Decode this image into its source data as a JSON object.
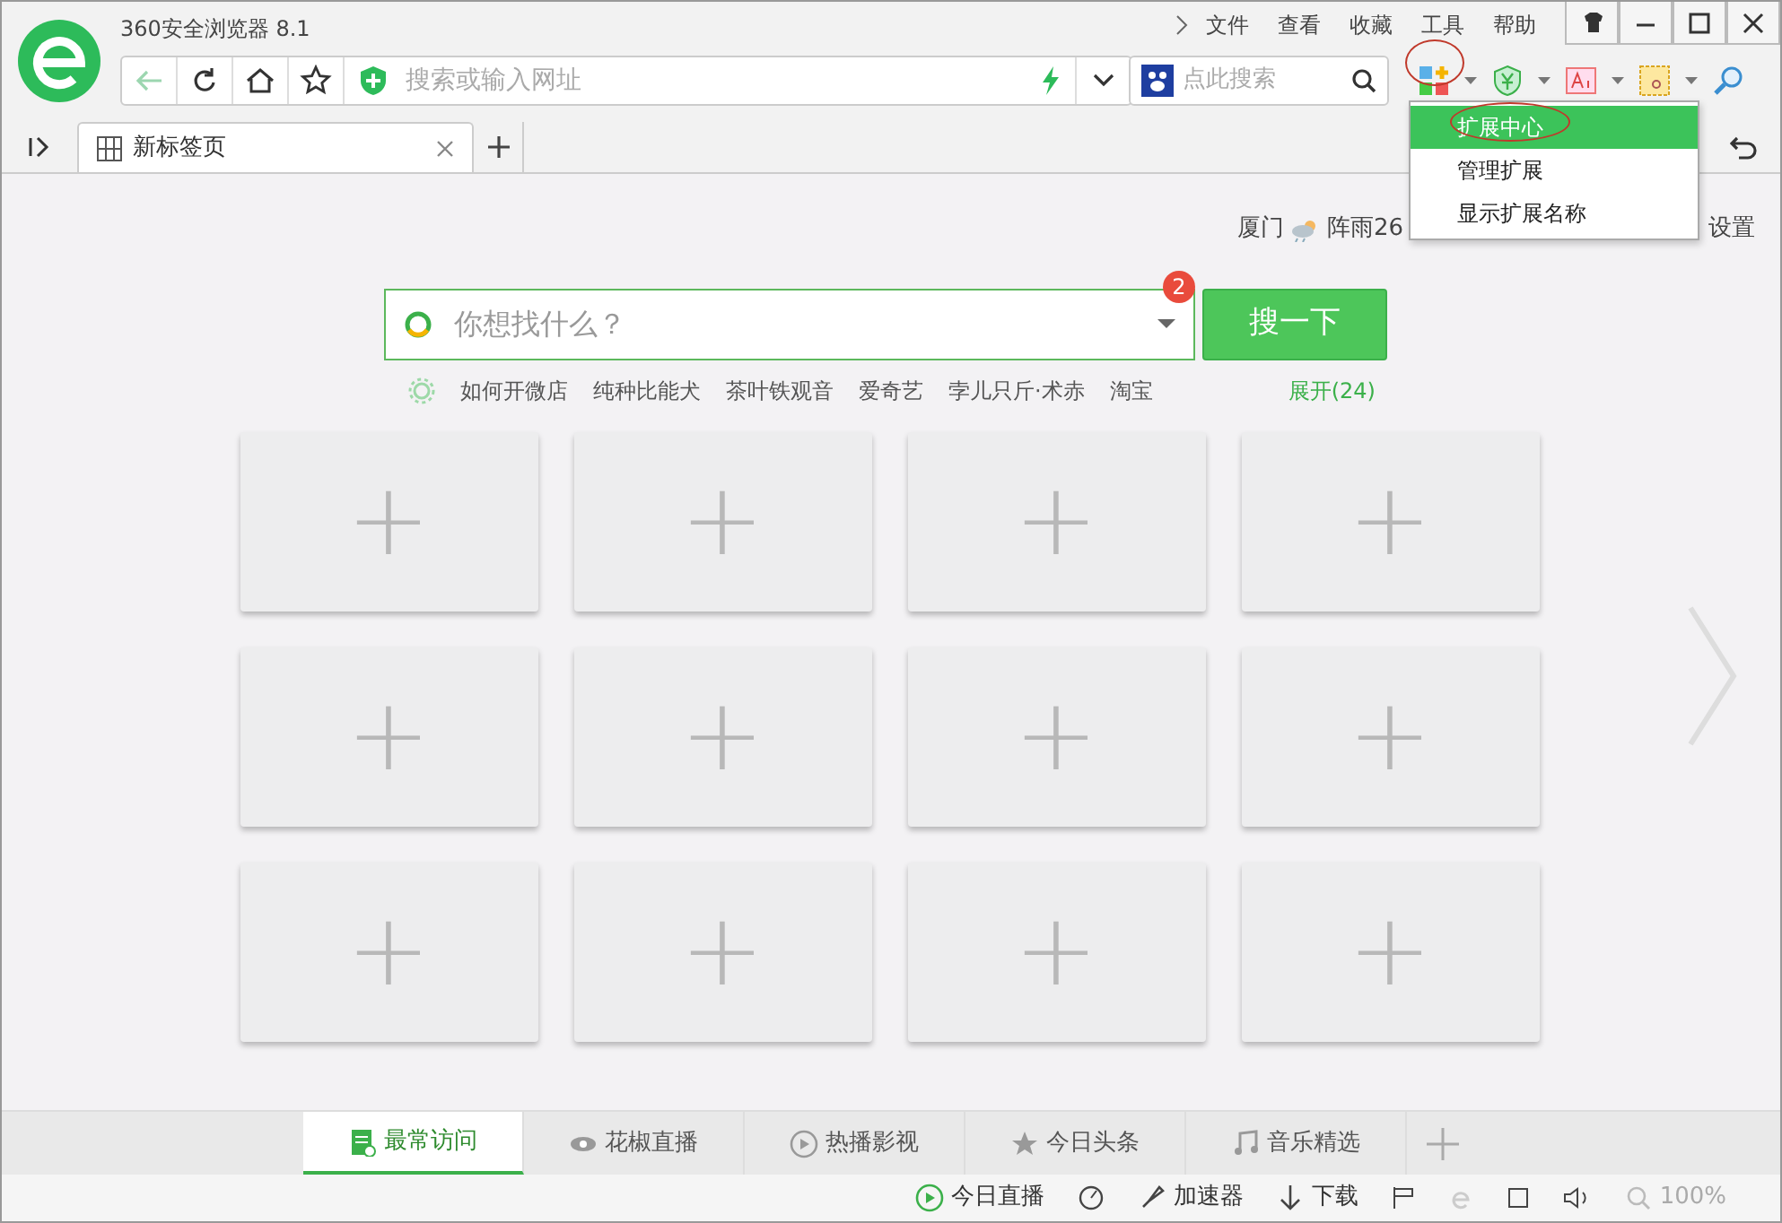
{
  "window": {
    "title": "360安全浏览器 8.1"
  },
  "menu": [
    "文件",
    "查看",
    "收藏",
    "工具",
    "帮助"
  ],
  "address": {
    "placeholder": "搜索或输入网址"
  },
  "search": {
    "placeholder": "点此搜索"
  },
  "tabs": [
    {
      "label": "新标签页",
      "selected": true
    }
  ],
  "extension_menu": [
    {
      "label": "扩展中心",
      "selected": true
    },
    {
      "label": "管理扩展",
      "selected": false
    },
    {
      "label": "显示扩展名称",
      "selected": false
    }
  ],
  "weather": {
    "city": "厦门",
    "reading": "阵雨26"
  },
  "settings": "设置",
  "main_search": {
    "placeholder": "你想找什么？",
    "badge": "2",
    "button": "搜一下"
  },
  "hot_words": [
    "如何开微店",
    "纯种比能犬",
    "茶叶铁观音",
    "爱奇艺",
    "孛儿只斤·术赤",
    "淘宝"
  ],
  "expand": "展开(24)",
  "tiles": [
    "+",
    "+",
    "+",
    "+",
    "+",
    "+",
    "+",
    "+",
    "+",
    "+",
    "+",
    "+"
  ],
  "bottom_tabs": [
    {
      "label": "最常访问",
      "selected": true
    },
    {
      "label": "花椒直播",
      "selected": false
    },
    {
      "label": "热播影视",
      "selected": false
    },
    {
      "label": "今日头条",
      "selected": false
    },
    {
      "label": "音乐精选",
      "selected": false
    }
  ],
  "status_bar": [
    {
      "kind": "play",
      "label": "今日直播"
    },
    {
      "kind": "accel",
      "label": "加速器"
    },
    {
      "kind": "download",
      "label": "下载"
    },
    {
      "kind": "zoom",
      "label": "100%"
    }
  ]
}
